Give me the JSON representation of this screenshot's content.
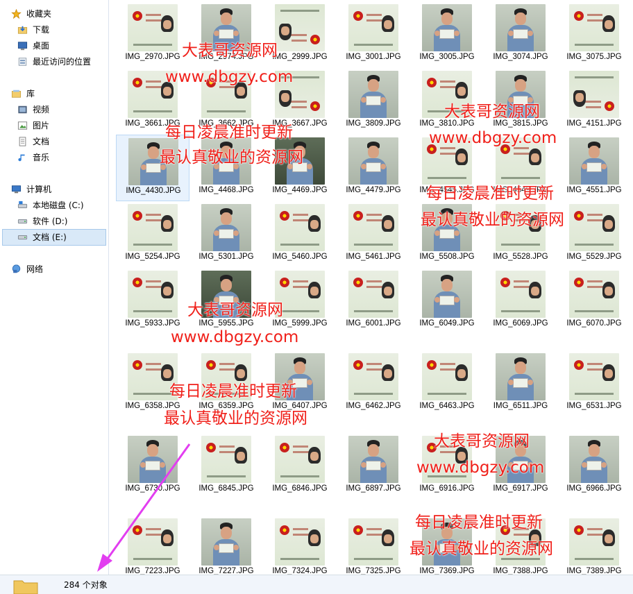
{
  "nav": {
    "favorites": "收藏夹",
    "downloads": "下载",
    "desktop": "桌面",
    "recent": "最近访问的位置",
    "libraries": "库",
    "videos": "视频",
    "pictures": "图片",
    "documents": "文档",
    "music": "音乐",
    "computer": "计算机",
    "drive_c": "本地磁盘 (C:)",
    "drive_d": "软件 (D:)",
    "drive_e": "文档 (E:)",
    "network": "网络"
  },
  "files": [
    "IMG_2970.JPG",
    "IMG_2974.JPG",
    "IMG_2999.JPG",
    "IMG_3001.JPG",
    "IMG_3005.JPG",
    "IMG_3074.JPG",
    "IMG_3075.JPG",
    "IMG_3661.JPG",
    "IMG_3662.JPG",
    "IMG_3667.JPG",
    "IMG_3809.JPG",
    "IMG_3810.JPG",
    "IMG_3815.JPG",
    "IMG_4151.JPG",
    "IMG_4430.JPG",
    "IMG_4468.JPG",
    "IMG_4469.JPG",
    "IMG_4479.JPG",
    "IMG_4545.JPG",
    "IMG_4549.JPG",
    "IMG_4551.JPG",
    "IMG_5254.JPG",
    "IMG_5301.JPG",
    "IMG_5460.JPG",
    "IMG_5461.JPG",
    "IMG_5508.JPG",
    "IMG_5528.JPG",
    "IMG_5529.JPG",
    "IMG_5933.JPG",
    "IMG_5955.JPG",
    "IMG_5999.JPG",
    "IMG_6001.JPG",
    "IMG_6049.JPG",
    "IMG_6069.JPG",
    "IMG_6070.JPG",
    "IMG_6358.JPG",
    "IMG_6359.JPG",
    "IMG_6407.JPG",
    "IMG_6462.JPG",
    "IMG_6463.JPG",
    "IMG_6511.JPG",
    "IMG_6531.JPG",
    "IMG_6730.JPG",
    "IMG_6845.JPG",
    "IMG_6846.JPG",
    "IMG_6897.JPG",
    "IMG_6916.JPG",
    "IMG_6917.JPG",
    "IMG_6966.JPG",
    "IMG_7223.JPG",
    "IMG_7227.JPG",
    "IMG_7324.JPG",
    "IMG_7325.JPG",
    "IMG_7369.JPG",
    "IMG_7388.JPG",
    "IMG_7389.JPG"
  ],
  "selected_file": "IMG_4430.JPG",
  "watermark": {
    "site_name": "大表哥资源网",
    "url": "www.dbgzy.com",
    "line1": "每日凌晨准时更新",
    "line2": "最认真敬业的资源网"
  },
  "status": {
    "count_text": "284 个对象"
  },
  "colors": {
    "watermark": "#f0201a",
    "arrow": "#e23ef0",
    "selection": "#d9e9f8"
  }
}
